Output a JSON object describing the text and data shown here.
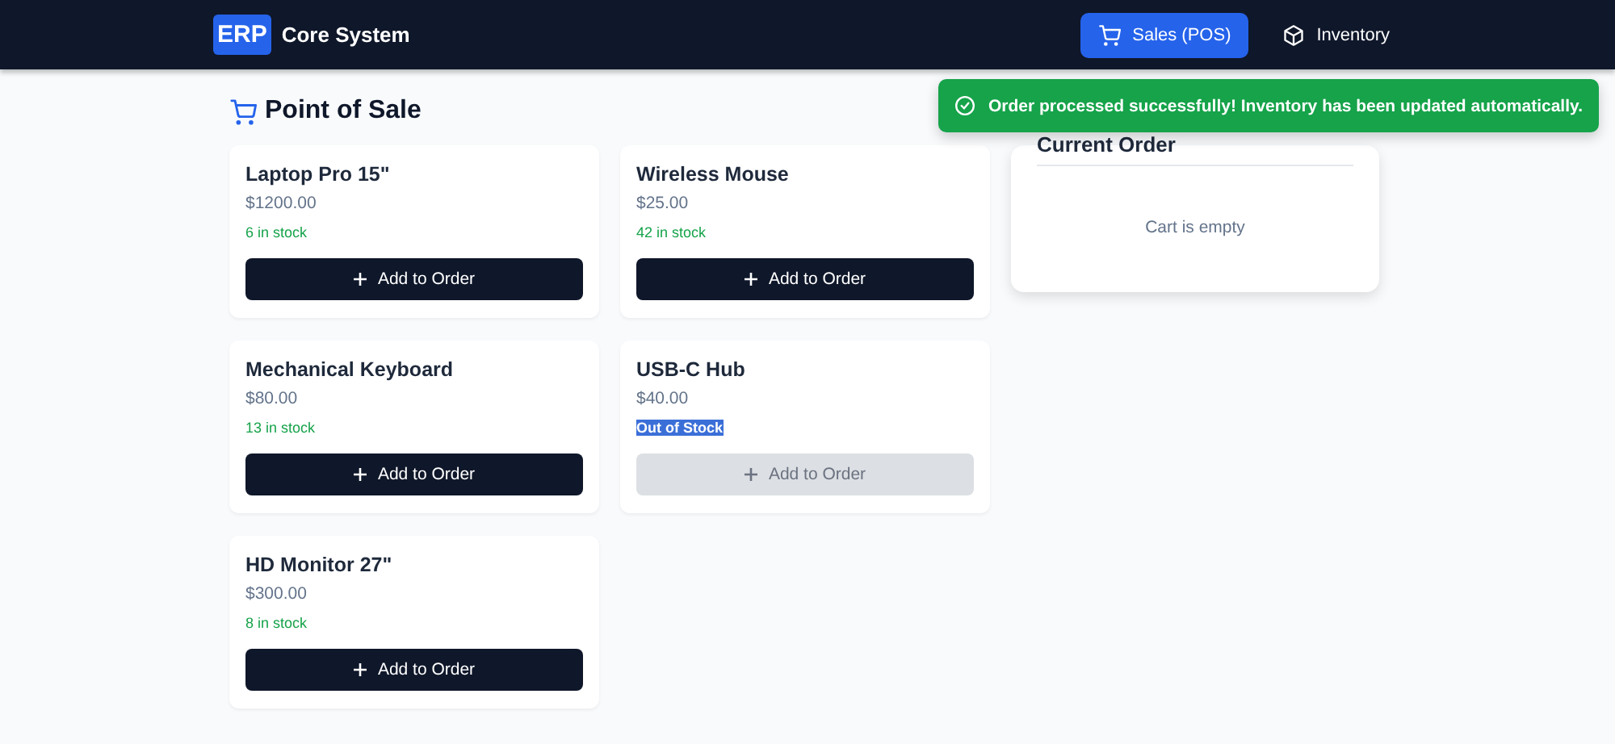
{
  "header": {
    "logo": "ERP",
    "title": "Core System",
    "nav": [
      {
        "label": "Sales (POS)",
        "selected": true,
        "kind": "cart"
      },
      {
        "label": "Inventory",
        "selected": false,
        "kind": "box"
      }
    ]
  },
  "toast": {
    "message": "Order processed successfully! Inventory has been updated automatically."
  },
  "page_title": "Point of Sale",
  "products": [
    {
      "name": "Laptop Pro 15\"",
      "price": "$1200.00",
      "stock": "6 in stock",
      "kind": "in-stock",
      "button": "Add to Order",
      "disabled": false
    },
    {
      "name": "Wireless Mouse",
      "price": "$25.00",
      "stock": "42 in stock",
      "kind": "in-stock",
      "button": "Add to Order",
      "disabled": false
    },
    {
      "name": "Mechanical Keyboard",
      "price": "$80.00",
      "stock": "13 in stock",
      "kind": "in-stock",
      "button": "Add to Order",
      "disabled": false
    },
    {
      "name": "USB-C Hub",
      "price": "$40.00",
      "stock": "Out of Stock",
      "kind": "out-of-stock",
      "button": "Add to Order",
      "disabled": true
    },
    {
      "name": "HD Monitor 27\"",
      "price": "$300.00",
      "stock": "8 in stock",
      "kind": "in-stock",
      "button": "Add to Order",
      "disabled": false
    }
  ],
  "order": {
    "title": "Current Order",
    "empty_text": "Cart is empty"
  }
}
